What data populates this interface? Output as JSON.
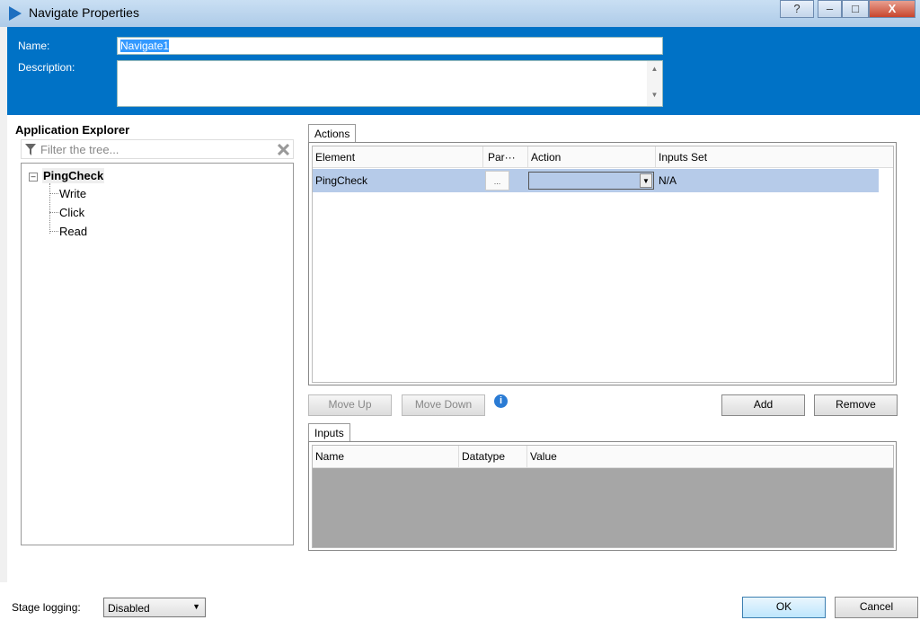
{
  "window": {
    "title": "Navigate Properties",
    "help": "?",
    "minimize": "–",
    "maximize": "□",
    "close": "X"
  },
  "header": {
    "name_label": "Name:",
    "name_value": "Navigate1",
    "description_label": "Description:",
    "description_value": ""
  },
  "explorer": {
    "title": "Application Explorer",
    "filter_placeholder": "Filter the tree...",
    "root": "PingCheck",
    "children": [
      "Write",
      "Click",
      "Read"
    ]
  },
  "actions": {
    "tab": "Actions",
    "columns": [
      "Element",
      "Par···",
      "Action",
      "Inputs Set"
    ],
    "rows": [
      {
        "element": "PingCheck",
        "params": "...",
        "action": "",
        "inputs_set": "N/A"
      }
    ]
  },
  "buttons": {
    "move_up": "Move Up",
    "move_down": "Move Down",
    "add": "Add",
    "remove": "Remove",
    "ok": "OK",
    "cancel": "Cancel"
  },
  "inputs": {
    "tab": "Inputs",
    "columns": [
      "Name",
      "Datatype",
      "Value"
    ]
  },
  "footer": {
    "stage_logging_label": "Stage logging:",
    "stage_logging_value": "Disabled"
  },
  "colors": {
    "header": "#0072c6",
    "selected_row": "#b6cbe9",
    "inputs_empty": "#a6a6a6"
  }
}
